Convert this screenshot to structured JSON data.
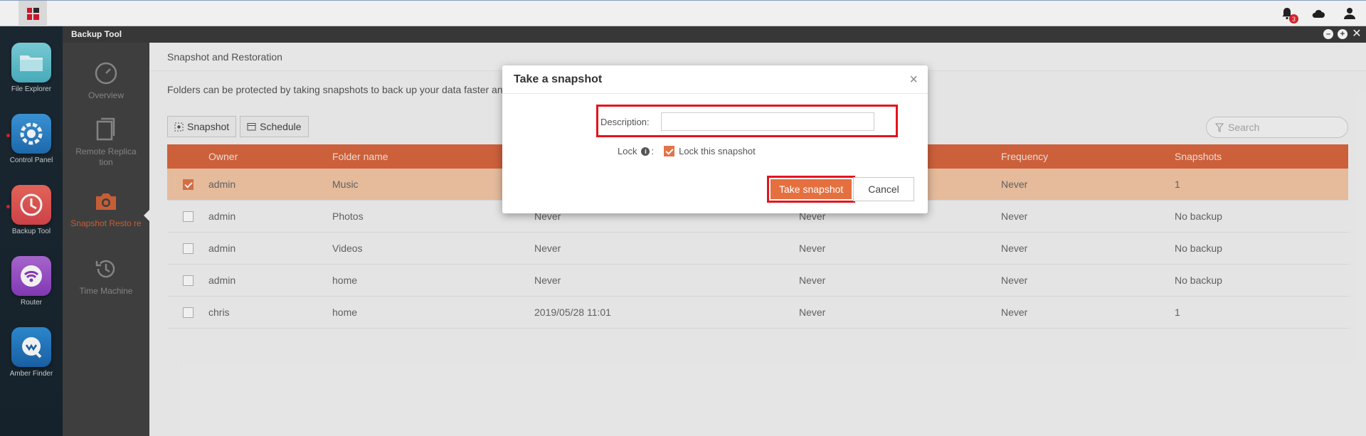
{
  "topbar": {
    "notification_count": "3"
  },
  "dock": {
    "items": [
      {
        "label": "File Explorer",
        "icon": "folder-icon"
      },
      {
        "label": "Control Panel",
        "icon": "gear-icon"
      },
      {
        "label": "Backup Tool",
        "icon": "backup-clock-icon"
      },
      {
        "label": "Router",
        "icon": "wifi-icon"
      },
      {
        "label": "Amber Finder",
        "icon": "finder-icon"
      }
    ]
  },
  "window": {
    "title": "Backup Tool",
    "sidebar": [
      {
        "label": "Overview"
      },
      {
        "label": "Remote Replica tion"
      },
      {
        "label": "Snapshot Resto re"
      },
      {
        "label": "Time Machine"
      }
    ],
    "breadcrumb": "Snapshot and Restoration",
    "info_text": "Folders can be protected by taking snapshots to back up your data faster and",
    "toolbar": {
      "snapshot_label": "Snapshot",
      "schedule_label": "Schedule"
    },
    "search": {
      "placeholder": "Search"
    },
    "table": {
      "headers": [
        "Owner",
        "Folder name",
        "",
        "",
        "Frequency",
        "Snapshots"
      ],
      "rows": [
        {
          "checked": true,
          "owner": "admin",
          "folder": "Music",
          "last": "",
          "next": "",
          "frequency": "Never",
          "snapshots": "1"
        },
        {
          "checked": false,
          "owner": "admin",
          "folder": "Photos",
          "last": "Never",
          "next": "Never",
          "frequency": "Never",
          "snapshots": "No backup"
        },
        {
          "checked": false,
          "owner": "admin",
          "folder": "Videos",
          "last": "Never",
          "next": "Never",
          "frequency": "Never",
          "snapshots": "No backup"
        },
        {
          "checked": false,
          "owner": "admin",
          "folder": "home",
          "last": "Never",
          "next": "Never",
          "frequency": "Never",
          "snapshots": "No backup"
        },
        {
          "checked": false,
          "owner": "chris",
          "folder": "home",
          "last": "2019/05/28 11:01",
          "next": "Never",
          "frequency": "Never",
          "snapshots": "1"
        }
      ]
    }
  },
  "modal": {
    "title": "Take a snapshot",
    "description_label": "Description:",
    "description_value": "",
    "lock_label": "Lock",
    "lock_checkbox_label": "Lock this snapshot",
    "lock_checked": true,
    "take_label": "Take snapshot",
    "cancel_label": "Cancel"
  },
  "colors": {
    "accent": "#e5703f",
    "table_header": "#d9673f",
    "highlight": "#e3141f"
  }
}
